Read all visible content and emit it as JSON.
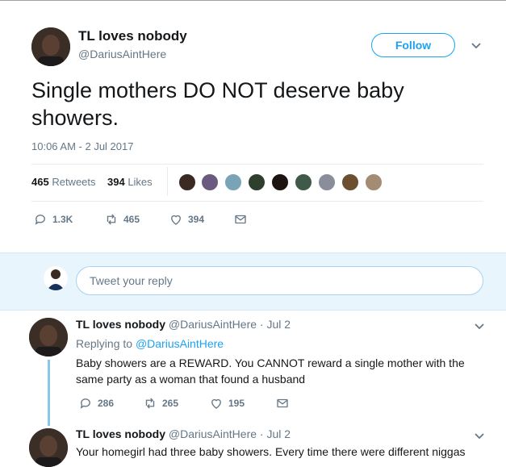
{
  "tweet": {
    "author_name": "TL loves nobody",
    "handle": "@DariusAintHere",
    "follow_label": "Follow",
    "text": "Single mothers DO NOT deserve baby showers.",
    "timestamp": "10:06 AM - 2 Jul 2017",
    "retweets_count": "465",
    "retweets_label": "Retweets",
    "likes_count": "394",
    "likes_label": "Likes",
    "actions": {
      "replies": "1.3K",
      "retweets": "465",
      "likes": "394"
    }
  },
  "reply_box": {
    "placeholder": "Tweet your reply"
  },
  "replies": [
    {
      "author_name": "TL loves nobody",
      "handle": "@DariusAintHere",
      "date": "· Jul 2",
      "replying_to_prefix": "Replying to",
      "replying_to_handle": "@DariusAintHere",
      "text": "Baby showers are a REWARD. You CANNOT reward a single mother with the same party as a woman that found a husband",
      "actions": {
        "replies": "286",
        "retweets": "265",
        "likes": "195"
      }
    },
    {
      "author_name": "TL loves nobody",
      "handle": "@DariusAintHere",
      "date": "· Jul 2",
      "text": "Your homegirl had three baby showers. Every time there were different niggas"
    }
  ],
  "colors": {
    "accent": "#1da1f2",
    "muted": "#657786",
    "reply_band": "#e8f5fd"
  }
}
